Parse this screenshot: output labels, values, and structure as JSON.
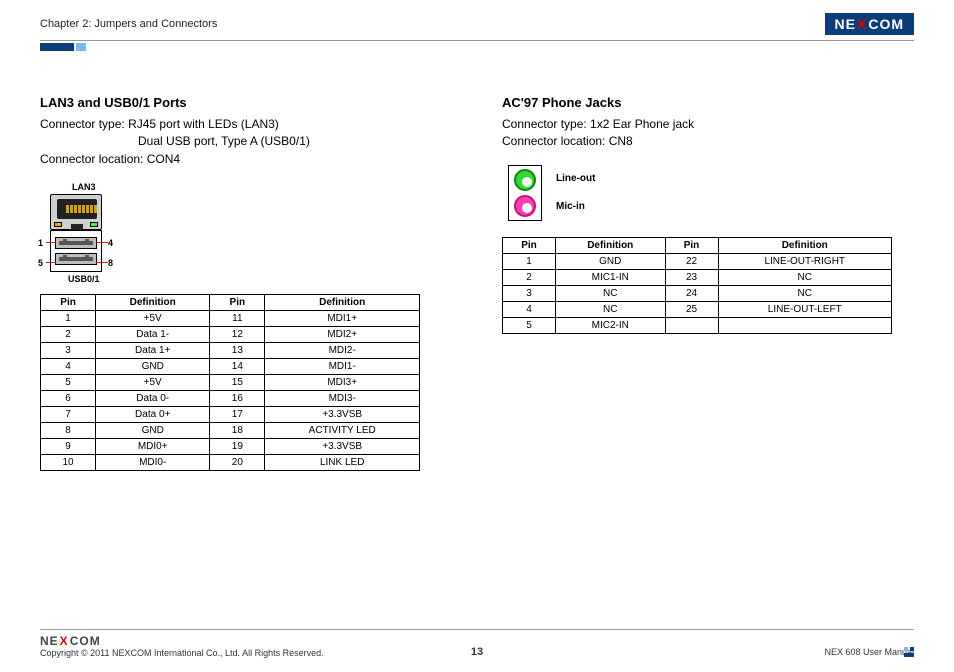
{
  "header": {
    "chapter": "Chapter 2: Jumpers and Connectors",
    "logo_pre": "NE",
    "logo_x": "X",
    "logo_post": "COM"
  },
  "left": {
    "title": "LAN3 and USB0/1 Ports",
    "conn_type_label": "Connector type:",
    "conn_type_line1": "RJ45 port with LEDs (LAN3)",
    "conn_type_line2": "Dual USB port, Type A (USB0/1)",
    "conn_loc": "Connector location: CON4",
    "diag": {
      "lan_label": "LAN3",
      "usb_label": "USB0/1",
      "p1": "1",
      "p4": "4",
      "p5": "5",
      "p8": "8"
    },
    "table": {
      "headers": [
        "Pin",
        "Definition",
        "Pin",
        "Definition"
      ],
      "rows": [
        [
          "1",
          "+5V",
          "11",
          "MDI1+"
        ],
        [
          "2",
          "Data 1-",
          "12",
          "MDI2+"
        ],
        [
          "3",
          "Data 1+",
          "13",
          "MDI2-"
        ],
        [
          "4",
          "GND",
          "14",
          "MDI1-"
        ],
        [
          "5",
          "+5V",
          "15",
          "MDI3+"
        ],
        [
          "6",
          "Data 0-",
          "16",
          "MDI3-"
        ],
        [
          "7",
          "Data 0+",
          "17",
          "+3.3VSB"
        ],
        [
          "8",
          "GND",
          "18",
          "ACTIVITY LED"
        ],
        [
          "9",
          "MDI0+",
          "19",
          "+3.3VSB"
        ],
        [
          "10",
          "MDI0-",
          "20",
          "LINK LED"
        ]
      ]
    }
  },
  "right": {
    "title": "AC'97 Phone Jacks",
    "conn_type": "Connector type: 1x2 Ear Phone jack",
    "conn_loc": "Connector location: CN8",
    "jacks": {
      "lineout": "Line-out",
      "micin": "Mic-in"
    },
    "table": {
      "headers": [
        "Pin",
        "Definition",
        "Pin",
        "Definition"
      ],
      "rows": [
        [
          "1",
          "GND",
          "22",
          "LINE-OUT-RIGHT"
        ],
        [
          "2",
          "MIC1-IN",
          "23",
          "NC"
        ],
        [
          "3",
          "NC",
          "24",
          "NC"
        ],
        [
          "4",
          "NC",
          "25",
          "LINE-OUT-LEFT"
        ],
        [
          "5",
          "MIC2-IN",
          "",
          ""
        ]
      ]
    }
  },
  "footer": {
    "copyright": "Copyright © 2011 NEXCOM International Co., Ltd. All Rights Reserved.",
    "page": "13",
    "manual": "NEX 608 User Manual"
  }
}
